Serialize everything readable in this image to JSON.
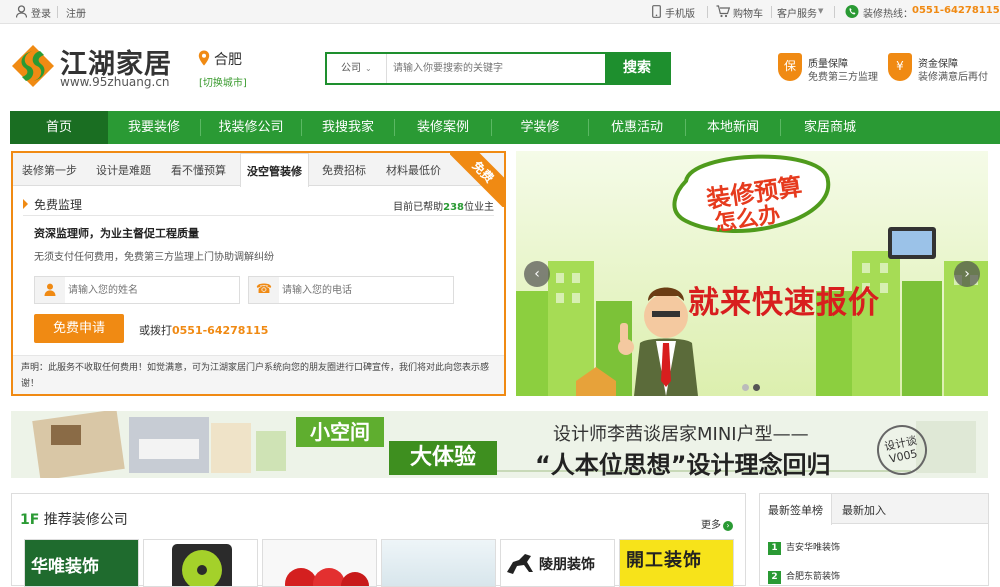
{
  "topbar": {
    "login": "登录",
    "register": "注册",
    "mobile": "手机版",
    "cart": "购物车",
    "service": "客户服务",
    "hotline_label": "装修热线：",
    "hotline_number": "0551-64278115"
  },
  "header": {
    "logo_cn": "江湖家居",
    "logo_url": "www.95zhuang.cn",
    "city": "合肥",
    "city_switch": "[切换城市]",
    "search_category": "公司",
    "search_placeholder": "请输入你要搜索的关键字",
    "search_button": "搜索",
    "guarantees": [
      {
        "icon": "保",
        "title": "质量保障",
        "sub": "免费第三方监理"
      },
      {
        "icon": "¥",
        "title": "资金保障",
        "sub": "装修满意后再付"
      }
    ]
  },
  "nav": [
    "首页",
    "我要装修",
    "找装修公司",
    "我搜我家",
    "装修案例",
    "学装修",
    "优惠活动",
    "本地新闻",
    "家居商城"
  ],
  "service_panel": {
    "tabs": [
      "装修第一步",
      "设计是难题",
      "看不懂预算",
      "没空管装修",
      "免费招标",
      "材料最低价"
    ],
    "active_tab": "没空管装修",
    "ribbon": "免费",
    "heading": "免费监理",
    "count_prefix": "目前已帮助",
    "count_value": "238",
    "count_suffix": "位业主",
    "title": "资深监理师，为业主督促工程质量",
    "desc": "无须支付任何费用，免费第三方监理上门协助调解纠纷",
    "name_placeholder": "请输入您的姓名",
    "phone_placeholder": "请输入您的电话",
    "apply_button": "免费申请",
    "call_prefix": "或拨打",
    "call_number": "0551-64278115",
    "note": "声明：此服务不收取任何费用！如觉满意，可为江湖家居门户系统向您的朋友圈进行口碑宣传，我们将对此向您表示感谢！"
  },
  "banner": {
    "line1": "装修预算",
    "line2": "怎么办",
    "slogan": "就来快速报价"
  },
  "ad": {
    "w1": "小空间",
    "w2": "大体验",
    "line1": "设计师李茜谈居家MINI户型——",
    "line2": "“人本位思想”设计理念回归",
    "stamp1": "设计谈",
    "stamp2": "V005"
  },
  "floor": {
    "num": "1F",
    "title": "推荐装修公司",
    "more": "更多",
    "logos": [
      "华唯装饰",
      "",
      "",
      "",
      "陵朋装饰",
      "開工装饰"
    ]
  },
  "side": {
    "tabs": [
      "最新签单榜",
      "最新加入"
    ],
    "rows": [
      {
        "n": "1",
        "text": "吉安华唯装饰"
      },
      {
        "n": "2",
        "text": "合肥东箭装饰"
      }
    ]
  }
}
